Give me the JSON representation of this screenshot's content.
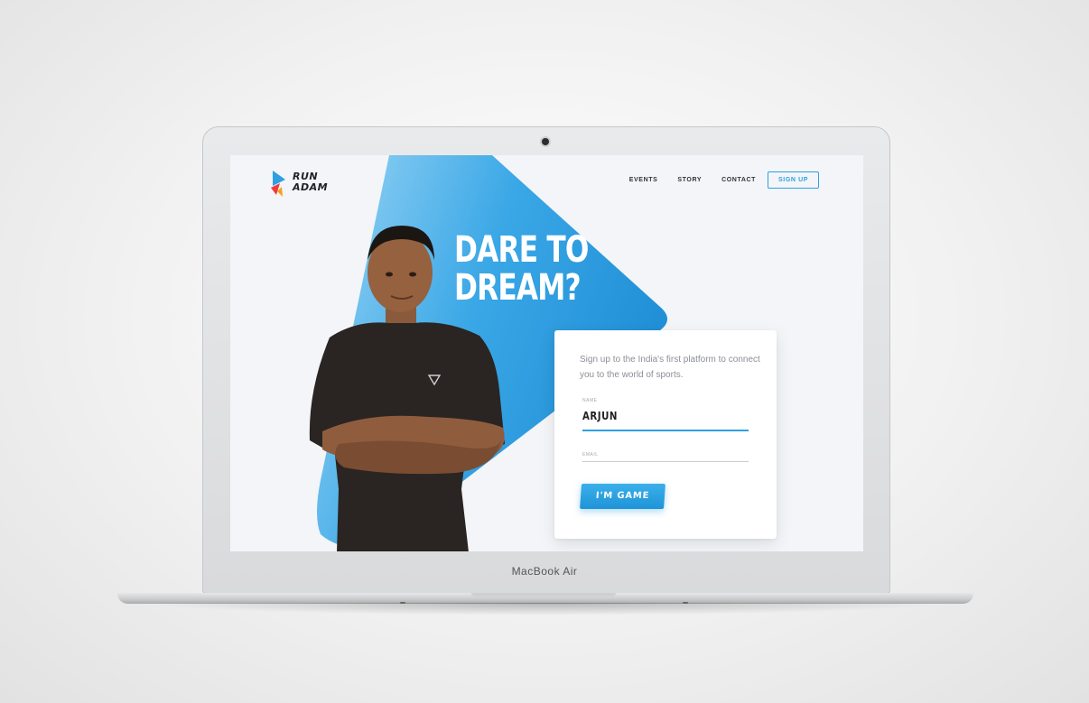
{
  "device": {
    "brand_label": "MacBook Air"
  },
  "site": {
    "logo": {
      "line1": "RUN",
      "line2": "ADAM"
    },
    "nav": {
      "items": [
        {
          "label": "EVENTS"
        },
        {
          "label": "STORY"
        },
        {
          "label": "CONTACT"
        }
      ],
      "cta_label": "SIGN UP"
    },
    "hero": {
      "headline_line1": "DARE TO",
      "headline_line2": "DREAM?"
    },
    "signup_card": {
      "intro": "Sign up to the India's first platform to connect you to the world of sports.",
      "name_field": {
        "label": "NAME",
        "value": "ARJUN"
      },
      "email_field": {
        "label": "EMAIL",
        "value": ""
      },
      "submit_label": "I'M GAME"
    }
  },
  "colors": {
    "accent": "#2ea0e0",
    "hero_gradient_start": "#7cc8f0",
    "hero_gradient_end": "#1f8fd6",
    "screen_background": "#f3f5f8"
  }
}
